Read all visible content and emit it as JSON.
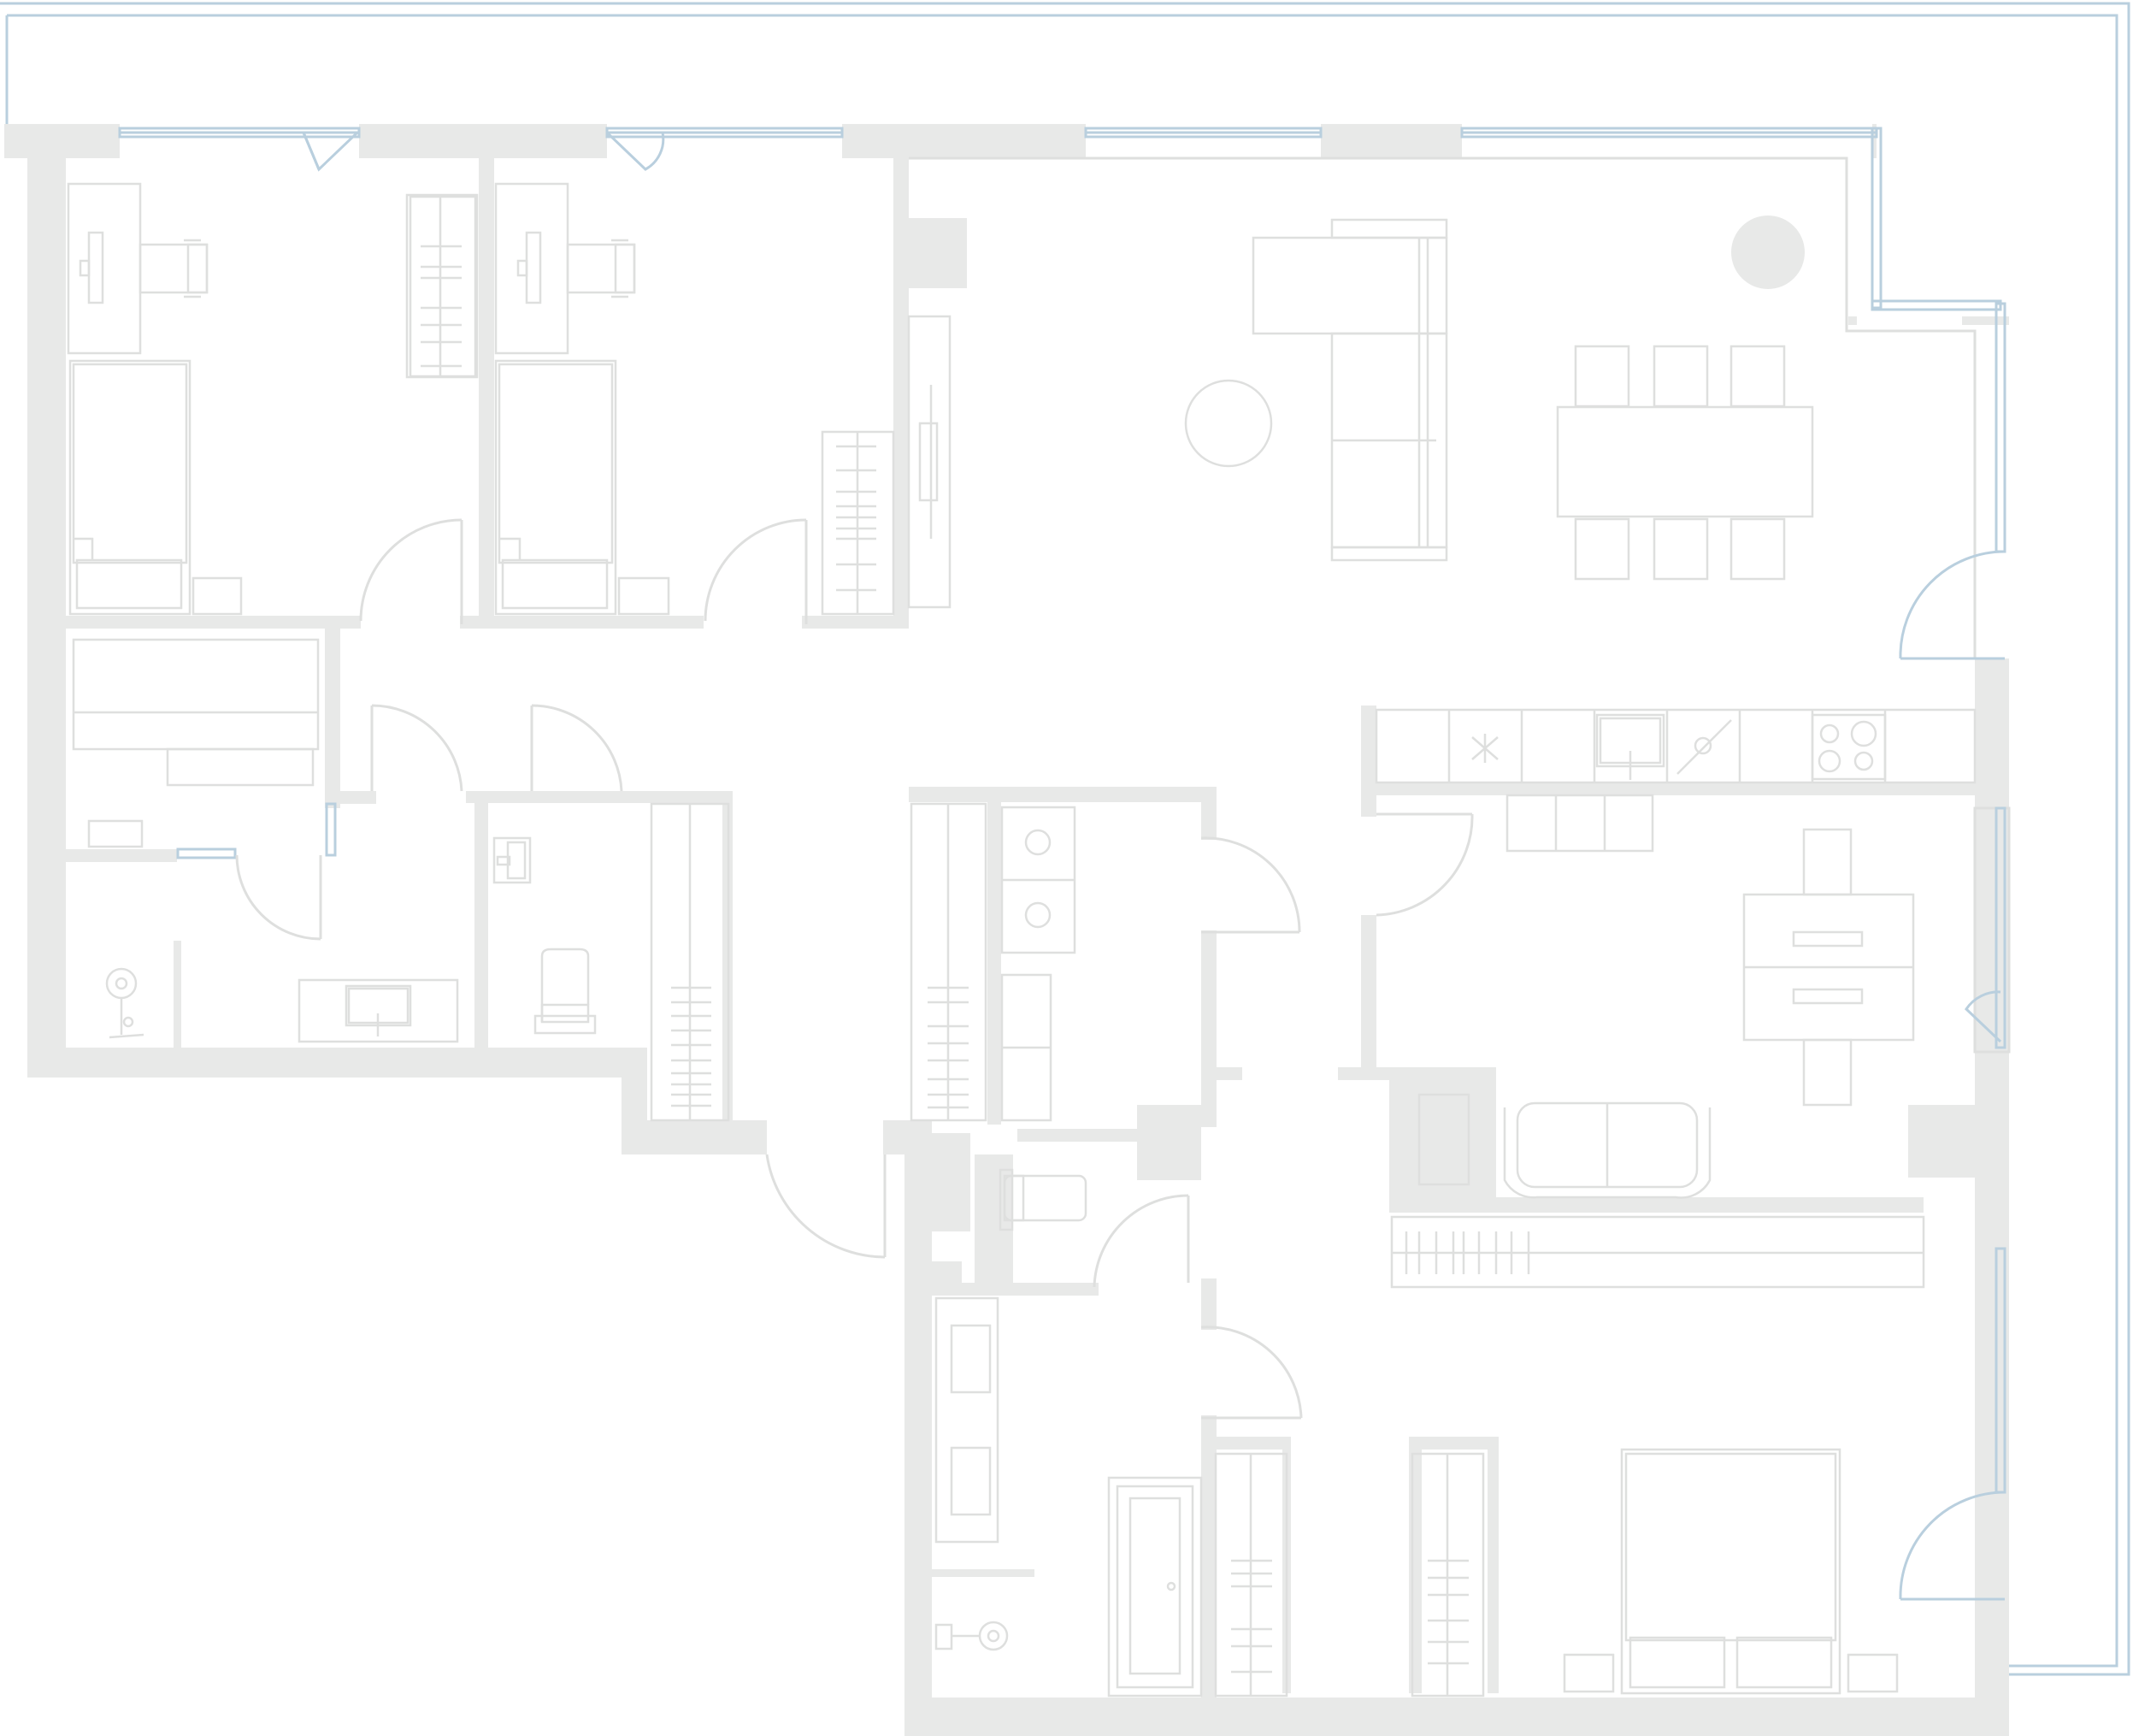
{
  "floor_plan": {
    "title": "",
    "labels": [],
    "colors": {
      "wall": "#e8e9e8",
      "line": "#dedfde",
      "glazing": "#b9cfde",
      "background": "#ffffff"
    },
    "rooms": [
      "bedroom-top-left",
      "bedroom-top-middle",
      "laundry-room",
      "bathroom-left",
      "wc-left",
      "hall-closet",
      "living-dining-room",
      "kitchen",
      "study-lounge",
      "wardrobe-room",
      "wc-center",
      "bathroom-center",
      "master-bedroom"
    ],
    "icons": [
      "desk-icon",
      "office-chair-icon",
      "bed-icon",
      "nightstand-icon",
      "wardrobe-icon",
      "sofa-icon",
      "dining-table-icon",
      "chair-icon",
      "round-table-icon",
      "plant-icon",
      "kitchen-counter-icon",
      "sink-icon",
      "cooktop-icon",
      "washing-machine-icon",
      "toilet-icon",
      "bathtub-icon",
      "shower-icon",
      "door-swing-icon",
      "window-icon"
    ]
  }
}
